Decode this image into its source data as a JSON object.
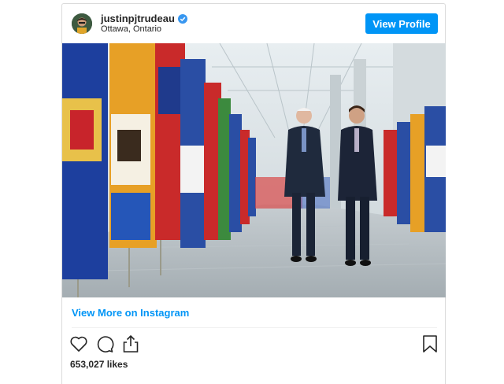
{
  "post": {
    "username": "justinpjtrudeau",
    "verified": true,
    "location": "Ottawa, Ontario",
    "view_profile_label": "View Profile",
    "view_more_label": "View More on Instagram",
    "likes": "653,027 likes"
  },
  "colors": {
    "accent": "#0095f6",
    "text": "#262626",
    "border": "#dbdbdb"
  },
  "icons": [
    "verified-badge-icon",
    "heart-icon",
    "comment-icon",
    "share-icon",
    "bookmark-icon"
  ]
}
